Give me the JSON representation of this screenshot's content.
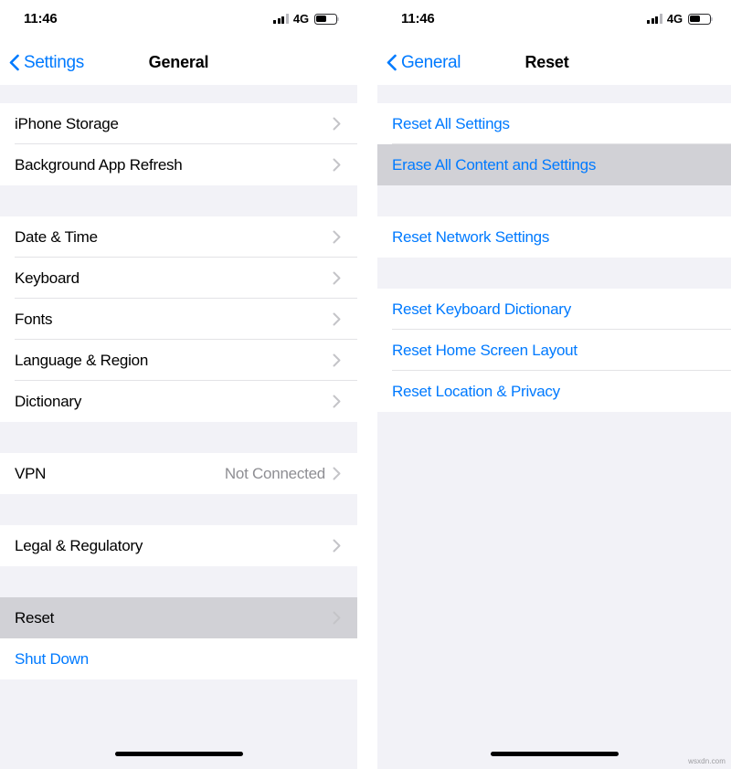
{
  "watermark": "wsxdn.com",
  "status_bar": {
    "time": "11:46",
    "network": "4G",
    "signal_icon": "cellular-signal-icon",
    "battery_icon": "battery-icon"
  },
  "panels": [
    {
      "id": "general",
      "nav": {
        "back_label": "Settings",
        "back_icon": "chevron-left-icon",
        "title": "General"
      },
      "sections": [
        {
          "rows": [
            {
              "label": "iPhone Storage",
              "accessory": "chevron-right-icon",
              "style": "default",
              "pressed": false
            },
            {
              "label": "Background App Refresh",
              "accessory": "chevron-right-icon",
              "style": "default",
              "pressed": false
            }
          ]
        },
        {
          "rows": [
            {
              "label": "Date & Time",
              "accessory": "chevron-right-icon",
              "style": "default",
              "pressed": false
            },
            {
              "label": "Keyboard",
              "accessory": "chevron-right-icon",
              "style": "default",
              "pressed": false
            },
            {
              "label": "Fonts",
              "accessory": "chevron-right-icon",
              "style": "default",
              "pressed": false
            },
            {
              "label": "Language & Region",
              "accessory": "chevron-right-icon",
              "style": "default",
              "pressed": false
            },
            {
              "label": "Dictionary",
              "accessory": "chevron-right-icon",
              "style": "default",
              "pressed": false
            }
          ]
        },
        {
          "rows": [
            {
              "label": "VPN",
              "value": "Not Connected",
              "accessory": "chevron-right-icon",
              "style": "default",
              "pressed": false
            }
          ]
        },
        {
          "rows": [
            {
              "label": "Legal & Regulatory",
              "accessory": "chevron-right-icon",
              "style": "default",
              "pressed": false
            }
          ]
        },
        {
          "rows": [
            {
              "label": "Reset",
              "accessory": "chevron-right-icon",
              "style": "default",
              "pressed": true
            },
            {
              "label": "Shut Down",
              "accessory": "none",
              "style": "tinted",
              "pressed": false
            }
          ]
        }
      ]
    },
    {
      "id": "reset",
      "nav": {
        "back_label": "General",
        "back_icon": "chevron-left-icon",
        "title": "Reset"
      },
      "sections": [
        {
          "rows": [
            {
              "label": "Reset All Settings",
              "accessory": "none",
              "style": "tinted",
              "pressed": false
            },
            {
              "label": "Erase All Content and Settings",
              "accessory": "none",
              "style": "tinted",
              "pressed": true
            }
          ]
        },
        {
          "rows": [
            {
              "label": "Reset Network Settings",
              "accessory": "none",
              "style": "tinted",
              "pressed": false
            }
          ]
        },
        {
          "rows": [
            {
              "label": "Reset Keyboard Dictionary",
              "accessory": "none",
              "style": "tinted",
              "pressed": false
            },
            {
              "label": "Reset Home Screen Layout",
              "accessory": "none",
              "style": "tinted",
              "pressed": false
            },
            {
              "label": "Reset Location & Privacy",
              "accessory": "none",
              "style": "tinted",
              "pressed": false
            }
          ]
        }
      ]
    }
  ],
  "colors": {
    "tint": "#007aff",
    "background": "#f2f2f7",
    "row": "#ffffff",
    "pressed": "#d1d1d6",
    "separator": "#e3e3e6",
    "secondary_text": "#8e8e93"
  }
}
